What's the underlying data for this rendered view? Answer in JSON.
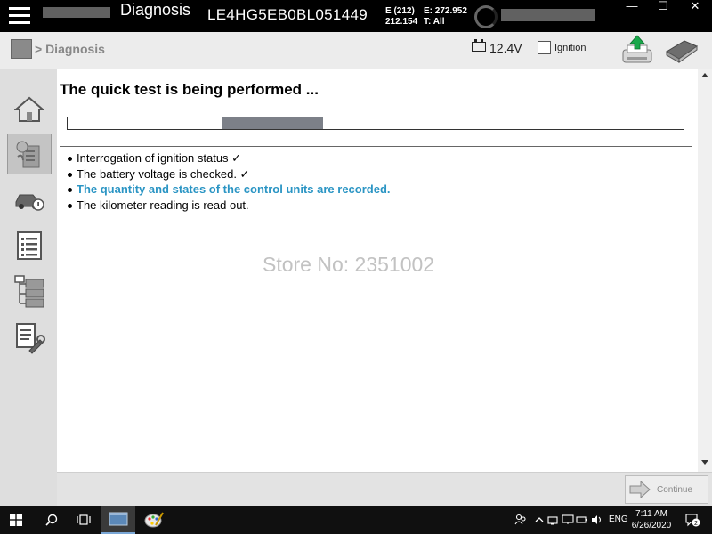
{
  "titlebar": {
    "app_title": "Diagnosis",
    "vin": "LE4HG5EB0BL051449",
    "meta": {
      "line1_left": "E (212)",
      "line1_right": "E: 272.952",
      "line2_left": "212.154",
      "line2_right": "T: All"
    },
    "window_controls": {
      "minimize": "—",
      "maximize": "☐",
      "close": "✕"
    }
  },
  "header": {
    "breadcrumb": "> Diagnosis",
    "voltage": "12.4V",
    "ignition_label": "Ignition"
  },
  "sidebar": {
    "items": [
      {
        "name": "home-icon"
      },
      {
        "name": "diagnosis-icon",
        "active": true
      },
      {
        "name": "vehicle-info-icon"
      },
      {
        "name": "list-icon"
      },
      {
        "name": "control-units-tree-icon"
      },
      {
        "name": "service-functions-icon"
      }
    ]
  },
  "main": {
    "heading": "The quick test is being performed ...",
    "progress": {
      "fill_start": 0.25,
      "fill_end": 0.415
    },
    "steps": [
      {
        "text": "Interrogation of ignition status ✓",
        "current": false
      },
      {
        "text": "The battery voltage is checked. ✓",
        "current": false
      },
      {
        "text": "The quantity and states of the control units are recorded.",
        "current": true
      },
      {
        "text": "The kilometer reading is read out.",
        "current": false
      }
    ],
    "watermark": "Store No: 2351002"
  },
  "footer": {
    "continue_label": "Continue"
  },
  "taskbar": {
    "tray": {
      "language": "ENG",
      "time": "7:11 AM",
      "date": "6/26/2020",
      "notification_count": "2"
    }
  },
  "colors": {
    "current_step": "#2b95c4",
    "progress_fill": "#7c8088",
    "upload_arrow": "#19a84a"
  }
}
